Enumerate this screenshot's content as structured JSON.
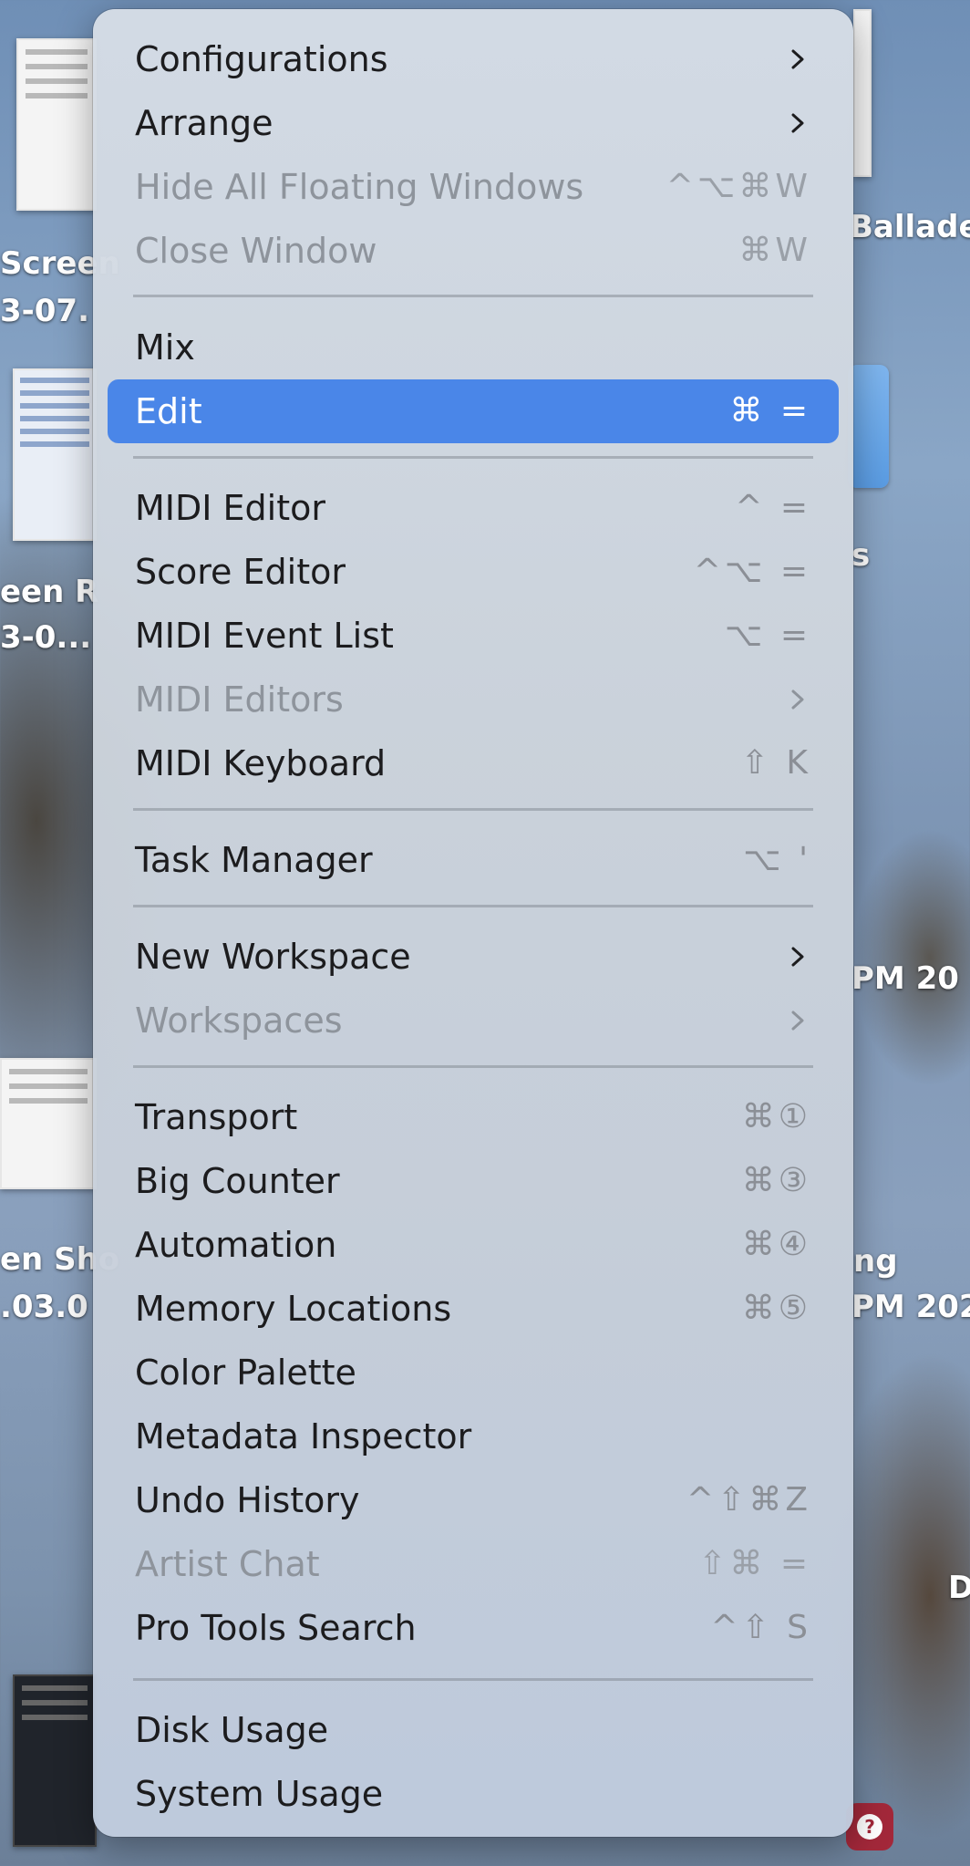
{
  "desktop": {
    "labels": [
      "Screen",
      "3-07.",
      "Ballade",
      "een R",
      "3-0...",
      "s",
      "PM   20",
      "en Sho",
      ".03.0",
      "ng",
      "PM   202",
      "D"
    ]
  },
  "menu": {
    "items": [
      {
        "label": "Configurations",
        "shortcut": "",
        "submenu": true,
        "disabled": false
      },
      {
        "label": "Arrange",
        "shortcut": "",
        "submenu": true,
        "disabled": false
      },
      {
        "label": "Hide All Floating Windows",
        "shortcut": "^⌥⌘W",
        "submenu": false,
        "disabled": true
      },
      {
        "label": "Close Window",
        "shortcut": "⌘W",
        "submenu": false,
        "disabled": true
      },
      {
        "label": "Mix",
        "shortcut": "",
        "submenu": false,
        "disabled": false
      },
      {
        "label": "Edit",
        "shortcut": "⌘ =",
        "submenu": false,
        "disabled": false,
        "highlighted": true
      },
      {
        "label": "MIDI Editor",
        "shortcut": "^ =",
        "submenu": false,
        "disabled": false
      },
      {
        "label": "Score Editor",
        "shortcut": "^⌥ =",
        "submenu": false,
        "disabled": false
      },
      {
        "label": "MIDI Event List",
        "shortcut": "⌥ =",
        "submenu": false,
        "disabled": false
      },
      {
        "label": "MIDI Editors",
        "shortcut": "",
        "submenu": true,
        "disabled": true
      },
      {
        "label": "MIDI Keyboard",
        "shortcut": "⇧ K",
        "submenu": false,
        "disabled": false
      },
      {
        "label": "Task Manager",
        "shortcut": "⌥ '",
        "submenu": false,
        "disabled": false
      },
      {
        "label": "New Workspace",
        "shortcut": "",
        "submenu": true,
        "disabled": false
      },
      {
        "label": "Workspaces",
        "shortcut": "",
        "submenu": true,
        "disabled": true
      },
      {
        "label": "Transport",
        "shortcut": "⌘①",
        "submenu": false,
        "disabled": false
      },
      {
        "label": "Big Counter",
        "shortcut": "⌘③",
        "submenu": false,
        "disabled": false
      },
      {
        "label": "Automation",
        "shortcut": "⌘④",
        "submenu": false,
        "disabled": false
      },
      {
        "label": "Memory Locations",
        "shortcut": "⌘⑤",
        "submenu": false,
        "disabled": false
      },
      {
        "label": "Color Palette",
        "shortcut": "",
        "submenu": false,
        "disabled": false
      },
      {
        "label": "Metadata Inspector",
        "shortcut": "",
        "submenu": false,
        "disabled": false
      },
      {
        "label": "Undo History",
        "shortcut": "^⇧⌘Z",
        "submenu": false,
        "disabled": false
      },
      {
        "label": "Artist Chat",
        "shortcut": "⇧⌘ =",
        "submenu": false,
        "disabled": true
      },
      {
        "label": "Pro Tools Search",
        "shortcut": "^⇧ S",
        "submenu": false,
        "disabled": false
      },
      {
        "label": "Disk Usage",
        "shortcut": "",
        "submenu": false,
        "disabled": false
      },
      {
        "label": "System Usage",
        "shortcut": "",
        "submenu": false,
        "disabled": false
      }
    ]
  },
  "colors": {
    "highlight": "#4a86e8",
    "text": "#1c1c1e",
    "disabled": "#8e949c",
    "help_badge": "#a3283a"
  }
}
